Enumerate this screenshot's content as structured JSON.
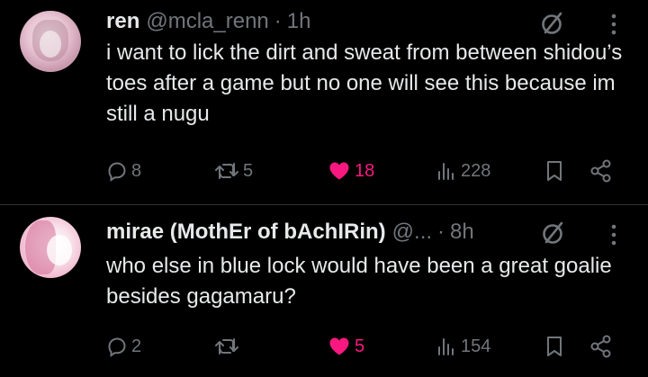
{
  "tweets": [
    {
      "name": "ren",
      "handle": "@mcla_renn",
      "time": "1h",
      "text": "i want to lick the dirt and sweat from between shidou’s toes after a game but no one will see this because im still a nugu",
      "replies": "8",
      "retweets": "5",
      "likes": "18",
      "liked": true,
      "views": "228"
    },
    {
      "name": "mirae (MothEr of bAchIRin)",
      "handle": "@...",
      "time": "8h",
      "text": "who else in blue lock would have been a great goalie besides gagamaru?",
      "replies": "2",
      "retweets": "",
      "likes": "5",
      "liked": true,
      "views": "154"
    }
  ],
  "colors": {
    "background": "#000000",
    "text": "#e7e9ea",
    "muted": "#71767b",
    "like": "#f91880",
    "divider": "#2f3336"
  },
  "icons": [
    "reply-icon",
    "retweet-icon",
    "heart-icon",
    "views-icon",
    "bookmark-icon",
    "share-icon",
    "no-sign-icon",
    "more-icon"
  ]
}
